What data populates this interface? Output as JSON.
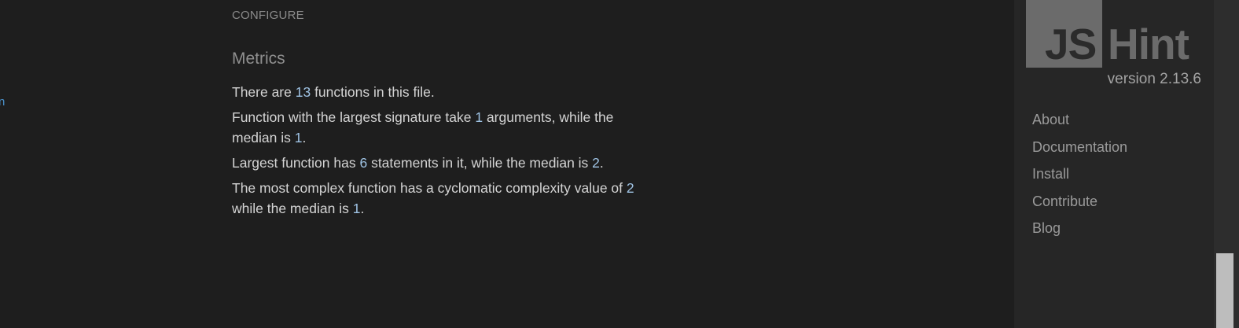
{
  "left_stub": {
    "text": "n"
  },
  "main": {
    "section_label": "CONFIGURE",
    "metrics_title": "Metrics",
    "metrics": [
      {
        "a": "There are ",
        "n1": "13",
        "b": " functions in this file.",
        "n2": "",
        "c": ""
      },
      {
        "a": "Function with the largest signature take ",
        "n1": "1",
        "b": " arguments, while the median is ",
        "n2": "1",
        "c": "."
      },
      {
        "a": "Largest function has ",
        "n1": "6",
        "b": " statements in it, while the median is ",
        "n2": "2",
        "c": "."
      },
      {
        "a": "The most complex function has a cyclomatic complexity value of ",
        "n1": "2",
        "b": " while the median is ",
        "n2": "1",
        "c": "."
      }
    ]
  },
  "sidebar": {
    "logo": {
      "js": "JS",
      "hint": "Hint"
    },
    "version": "version 2.13.6",
    "nav": [
      {
        "label": "About"
      },
      {
        "label": "Documentation"
      },
      {
        "label": "Install"
      },
      {
        "label": "Contribute"
      },
      {
        "label": "Blog"
      }
    ]
  }
}
